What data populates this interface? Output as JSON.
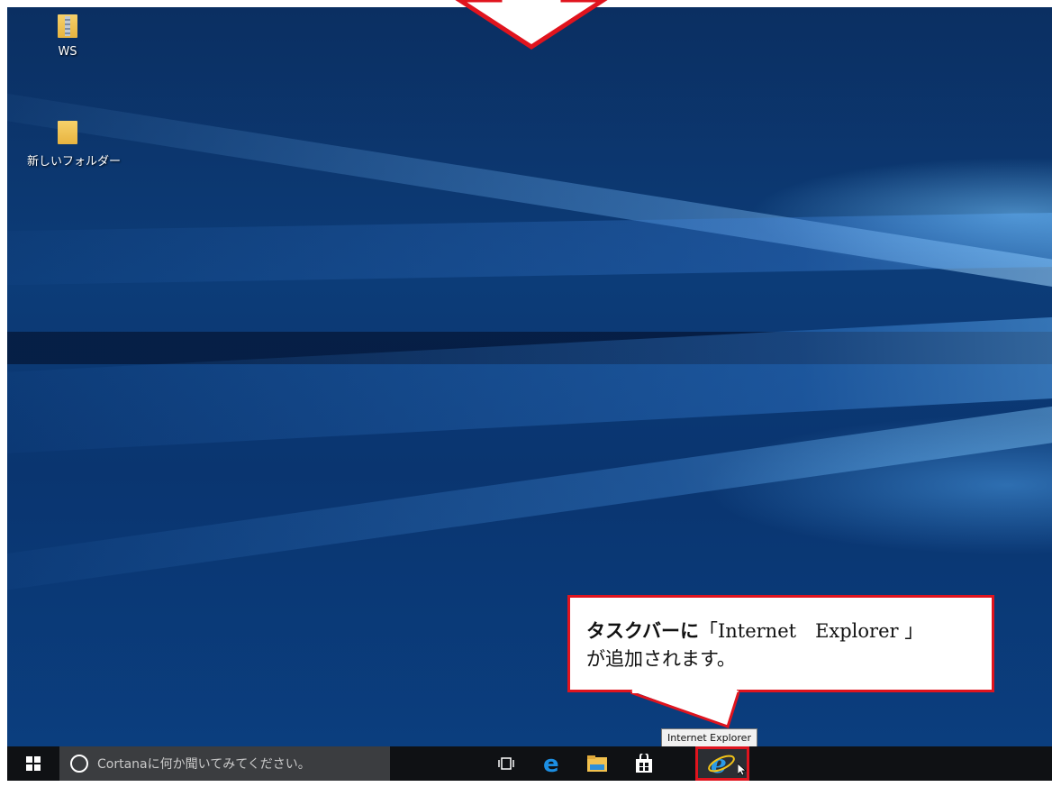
{
  "desktop": {
    "icons": [
      {
        "label": "WS",
        "icon": "zip-folder-icon"
      },
      {
        "label": "新しいフォルダー",
        "icon": "folder-icon"
      }
    ]
  },
  "callout": {
    "line1_bold": "タスクバーに",
    "line1_rest": "「Internet　Explorer 」",
    "line2": "が追加されます。",
    "border_color": "#e0141e"
  },
  "tooltip": {
    "text": "Internet Explorer"
  },
  "taskbar": {
    "start_icon": "windows-logo-icon",
    "search_placeholder": "Cortanaに何か聞いてみてください。",
    "apps": [
      {
        "name": "task-view",
        "icon": "task-view-icon"
      },
      {
        "name": "edge",
        "icon": "edge-icon"
      },
      {
        "name": "file-explorer",
        "icon": "file-explorer-icon"
      },
      {
        "name": "store",
        "icon": "store-icon"
      },
      {
        "name": "internet-explorer",
        "icon": "internet-explorer-icon",
        "highlighted": true
      }
    ]
  }
}
